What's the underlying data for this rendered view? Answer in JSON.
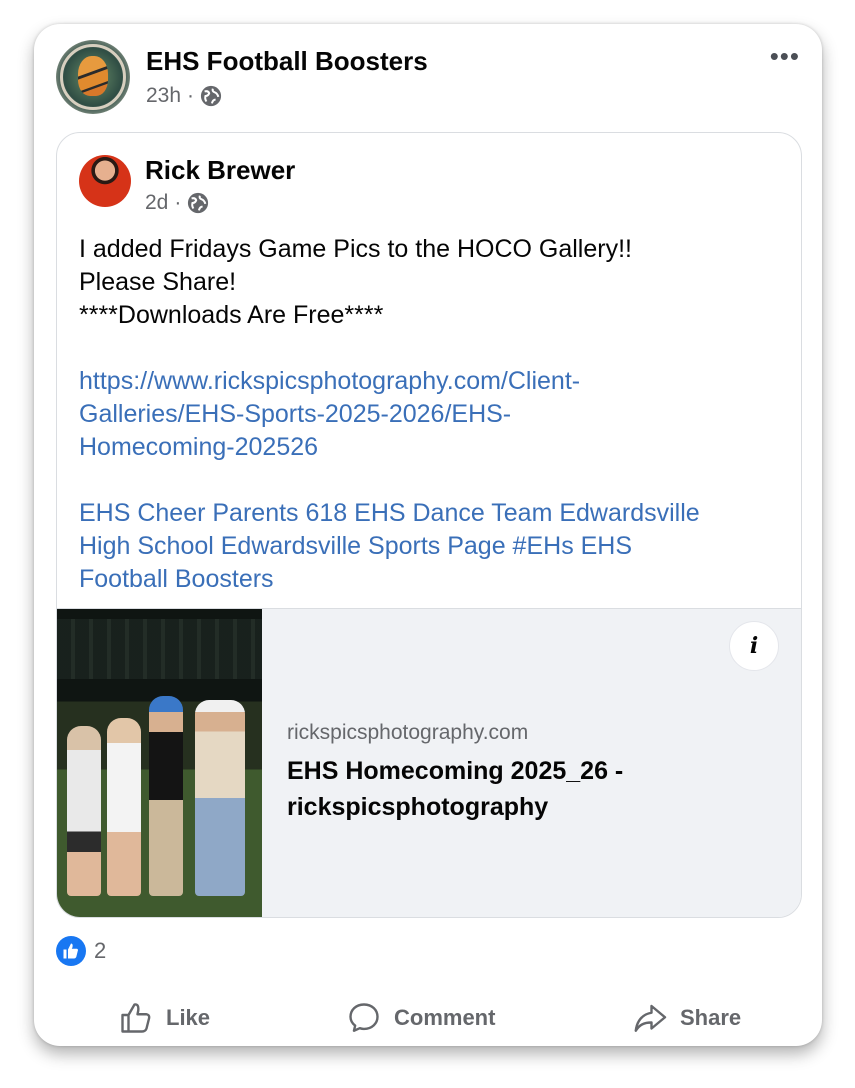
{
  "post": {
    "page_name": "EHS Football Boosters",
    "time": "23h",
    "more_label": "•••"
  },
  "shared_post": {
    "author": "Rick Brewer",
    "time": "2d",
    "text_lines": [
      "I added Fridays Game Pics to the HOCO Gallery!!",
      "Please Share!",
      "****Downloads Are Free****"
    ],
    "url_lines": [
      "https://www.rickspicsphotography.com/Client-",
      "Galleries/EHS-Sports-2025-2026/EHS-",
      "Homecoming-202526"
    ],
    "tag_lines": [
      "EHS Cheer Parents 618 EHS Dance Team Edwardsville",
      "High School Edwardsville Sports Page #EHs EHS",
      "Football Boosters"
    ],
    "link_preview": {
      "domain": "rickspicsphotography.com",
      "title_lines": [
        "EHS Homecoming 2025_26 -",
        "rickspicsphotography"
      ],
      "info_label": "i"
    }
  },
  "reactions": {
    "count": "2",
    "icon": "thumbs-up-icon"
  },
  "actions": {
    "like": "Like",
    "comment": "Comment",
    "share": "Share"
  },
  "colors": {
    "link": "#3a6fb8",
    "like_badge": "#1877f2",
    "meta": "#65676b"
  }
}
